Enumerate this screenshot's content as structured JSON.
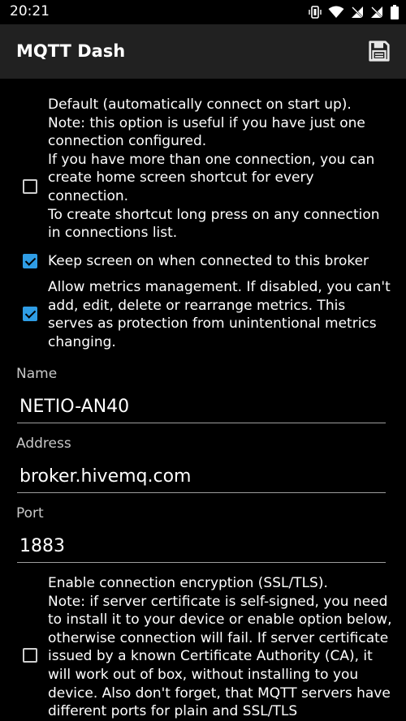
{
  "status": {
    "time": "20:21",
    "icons": [
      "vibrate-icon",
      "wifi-icon",
      "no-signal-icon",
      "no-signal-icon",
      "battery-icon"
    ]
  },
  "appbar": {
    "title": "MQTT Dash",
    "save_icon": "save-icon"
  },
  "options": {
    "default": {
      "checked": false,
      "text": "Default (automatically connect on start up).\nNote: this option is useful if you have just one connection configured.\nIf you have more than one connection, you can create home screen shortcut for every connection.\nTo create shortcut long press on any connection in connections list."
    },
    "keep_screen": {
      "checked": true,
      "text": "Keep screen on when connected to this broker"
    },
    "metrics": {
      "checked": true,
      "text": "Allow metrics management. If disabled, you can't add, edit, delete or rearrange metrics. This serves as protection from unintentional metrics changing."
    },
    "ssl": {
      "checked": false,
      "text": "Enable connection encryption (SSL/TLS).\nNote: if server certificate is self-signed, you need to install it to your device or enable option below, otherwise connection will fail. If server certificate issued by a known Certificate Authority (CA), it will work out of box, without installing to you device. Also don't forget, that MQTT servers have different ports for plain and SSL/TLS"
    }
  },
  "fields": {
    "name": {
      "label": "Name",
      "value": "NETIO-AN40"
    },
    "address": {
      "label": "Address",
      "value": "broker.hivemq.com"
    },
    "port": {
      "label": "Port",
      "value": "1883"
    }
  },
  "colors": {
    "accent": "#2f9de5",
    "appbar": "#212121",
    "background": "#000000"
  }
}
